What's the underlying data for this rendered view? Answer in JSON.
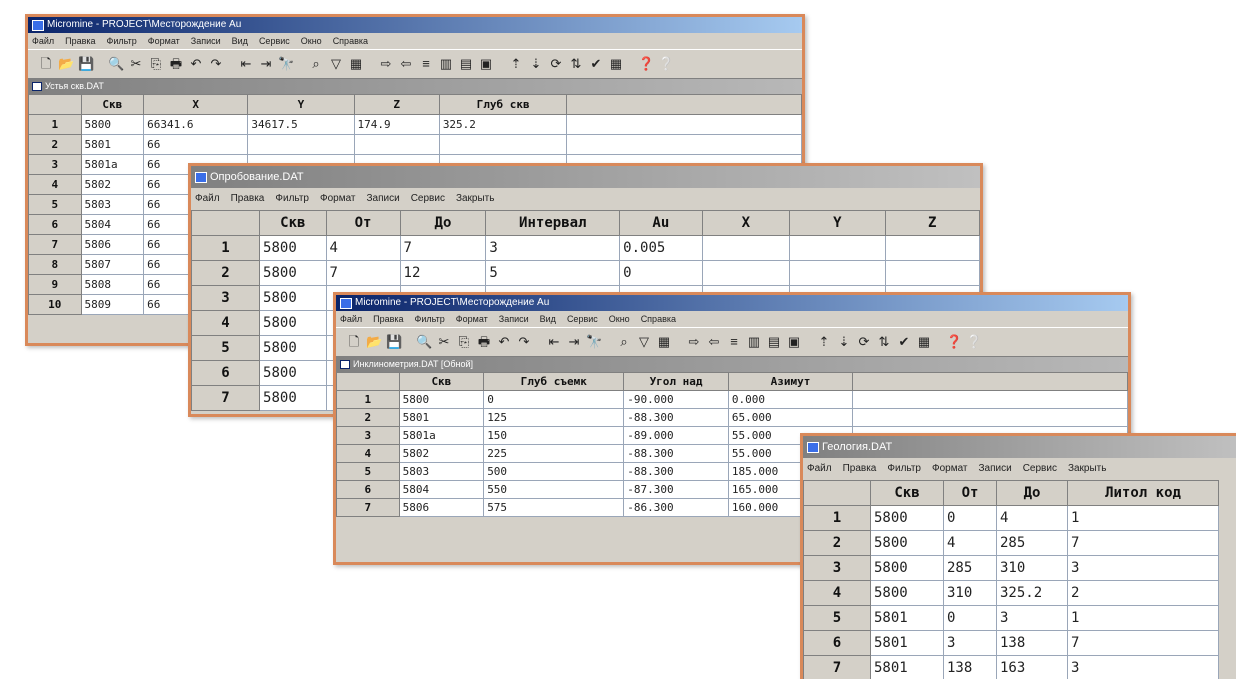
{
  "toolbar_icons": [
    "new-icon",
    "open-icon",
    "save-icon",
    "preview-icon",
    "cut-icon",
    "copy-icon",
    "print-icon",
    "undo-icon",
    "redo-icon",
    "insert-icon",
    "move-icon",
    "find-icon",
    "filter-icon",
    "funnel-icon",
    "table-icon",
    "arrow-right-icon",
    "arrow-left-icon",
    "join-icon",
    "grid-icon",
    "grid2-icon",
    "grid3-icon",
    "sort-asc-icon",
    "sort-desc-icon",
    "refresh-icon",
    "sort-icon",
    "check-icon",
    "calc-icon",
    "help-icon",
    "context-help-icon"
  ],
  "toolbar_glyphs": [
    "🗋",
    "📂",
    "💾",
    "🔍",
    "✂",
    "⎘",
    "🖶",
    "↶",
    "↷",
    "⇤",
    "⇥",
    "🔭",
    "⌕",
    "▽",
    "▦",
    "⇨",
    "⇦",
    "≡",
    "▥",
    "▤",
    "▣",
    "⇡",
    "⇣",
    "⟳",
    "⇅",
    "✔",
    "▦",
    "❓",
    "❔"
  ],
  "win1": {
    "title": "Micromine - PROJECT\\Месторождение Au",
    "menu": [
      "Файл",
      "Правка",
      "Фильтр",
      "Формат",
      "Записи",
      "Вид",
      "Сервис",
      "Окно",
      "Справка"
    ],
    "child_title": "Устья скв.DAT",
    "columns": [
      "",
      "Скв",
      "X",
      "Y",
      "Z",
      "Глуб скв",
      ""
    ],
    "rows": [
      [
        "1",
        "5800",
        "66341.6",
        "34617.5",
        "174.9",
        "325.2",
        ""
      ],
      [
        "2",
        "5801",
        "66",
        "",
        "",
        "",
        ""
      ],
      [
        "3",
        "5801a",
        "66",
        "",
        "",
        "",
        ""
      ],
      [
        "4",
        "5802",
        "66",
        "",
        "",
        "",
        ""
      ],
      [
        "5",
        "5803",
        "66",
        "",
        "",
        "",
        ""
      ],
      [
        "6",
        "5804",
        "66",
        "",
        "",
        "",
        ""
      ],
      [
        "7",
        "5806",
        "66",
        "",
        "",
        "",
        ""
      ],
      [
        "8",
        "5807",
        "66",
        "",
        "",
        "",
        ""
      ],
      [
        "9",
        "5808",
        "66",
        "",
        "",
        "",
        ""
      ],
      [
        "10",
        "5809",
        "66",
        "",
        "",
        "",
        ""
      ]
    ]
  },
  "win2": {
    "title": "Опробование.DAT",
    "menu": [
      "Файл",
      "Правка",
      "Фильтр",
      "Формат",
      "Записи",
      "Сервис",
      "Закрыть"
    ],
    "columns": [
      "",
      "Скв",
      "От",
      "До",
      "Интервал",
      "Au",
      "X",
      "Y",
      "Z"
    ],
    "rows": [
      [
        "1",
        "5800",
        "4",
        "7",
        "3",
        "0.005",
        "",
        "",
        ""
      ],
      [
        "2",
        "5800",
        "7",
        "12",
        "5",
        "0",
        "",
        "",
        ""
      ],
      [
        "3",
        "5800",
        "",
        "",
        "",
        "",
        "",
        "",
        ""
      ],
      [
        "4",
        "5800",
        "",
        "",
        "",
        "",
        "",
        "",
        ""
      ],
      [
        "5",
        "5800",
        "",
        "",
        "",
        "",
        "",
        "",
        ""
      ],
      [
        "6",
        "5800",
        "",
        "",
        "",
        "",
        "",
        "",
        ""
      ],
      [
        "7",
        "5800",
        "",
        "",
        "",
        "",
        "",
        "",
        ""
      ]
    ]
  },
  "win3": {
    "title": "Micromine - PROJECT\\Месторождение Au",
    "menu": [
      "Файл",
      "Правка",
      "Фильтр",
      "Формат",
      "Записи",
      "Вид",
      "Сервис",
      "Окно",
      "Справка"
    ],
    "child_title": "Инклинометрия.DAT [Обной]",
    "columns": [
      "",
      "Скв",
      "Глуб съемк",
      "Угол над",
      "Азимут",
      ""
    ],
    "rows": [
      [
        "1",
        "5800",
        "0",
        "-90.000",
        "0.000",
        ""
      ],
      [
        "2",
        "5801",
        "125",
        "-88.300",
        "65.000",
        ""
      ],
      [
        "3",
        "5801a",
        "150",
        "-89.000",
        "55.000",
        ""
      ],
      [
        "4",
        "5802",
        "225",
        "-88.300",
        "55.000",
        ""
      ],
      [
        "5",
        "5803",
        "500",
        "-88.300",
        "185.000",
        ""
      ],
      [
        "6",
        "5804",
        "550",
        "-87.300",
        "165.000",
        ""
      ],
      [
        "7",
        "5806",
        "575",
        "-86.300",
        "160.000",
        ""
      ]
    ]
  },
  "win4": {
    "title": "Геология.DAT",
    "menu": [
      "Файл",
      "Правка",
      "Фильтр",
      "Формат",
      "Записи",
      "Сервис",
      "Закрыть"
    ],
    "columns": [
      "",
      "Скв",
      "От",
      "До",
      "Литол код"
    ],
    "rows": [
      [
        "1",
        "5800",
        "0",
        "4",
        "1"
      ],
      [
        "2",
        "5800",
        "4",
        "285",
        "7"
      ],
      [
        "3",
        "5800",
        "285",
        "310",
        "3"
      ],
      [
        "4",
        "5800",
        "310",
        "325.2",
        "2"
      ],
      [
        "5",
        "5801",
        "0",
        "3",
        "1"
      ],
      [
        "6",
        "5801",
        "3",
        "138",
        "7"
      ],
      [
        "7",
        "5801",
        "138",
        "163",
        "3"
      ]
    ]
  },
  "colors": {
    "window_border": "#d9895a",
    "title_active": "#0a246a",
    "face": "#d4d0c8"
  }
}
